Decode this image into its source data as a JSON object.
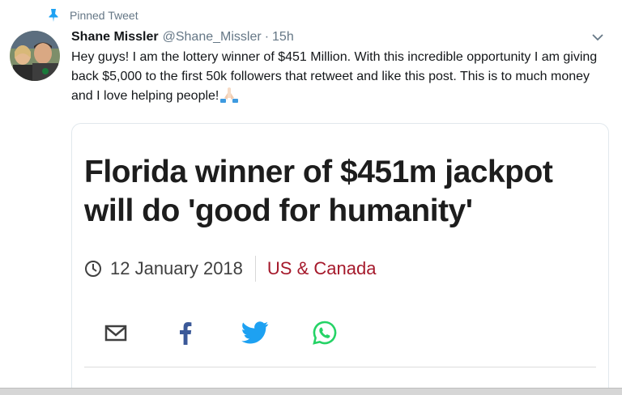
{
  "pinned": {
    "label": "Pinned Tweet",
    "icon": "pin-icon",
    "color": "#1da1f2"
  },
  "tweet": {
    "author_name": "Shane Missler",
    "author_handle": "@Shane_Missler",
    "separator": "·",
    "time": "15h",
    "text": "Hey guys! I am the lottery winner of $451 Million. With this incredible opportunity I am giving back $5,000 to the first 50k followers that retweet and like this post. This is to much money and I love helping people!",
    "emoji": "folded-hands-emoji",
    "avatar_icon": "avatar"
  },
  "card": {
    "headline": "Florida winner of $451m jackpot will do 'good for humanity'",
    "date": "12 January 2018",
    "section": "US & Canada",
    "section_color": "#a5192b",
    "share": [
      {
        "name": "email",
        "icon": "mail-icon",
        "color": "#404040"
      },
      {
        "name": "facebook",
        "icon": "facebook-icon",
        "color": "#3b5998"
      },
      {
        "name": "twitter",
        "icon": "twitter-icon",
        "color": "#1da1f2"
      },
      {
        "name": "whatsapp",
        "icon": "whatsapp-icon",
        "color": "#25d366"
      }
    ]
  }
}
